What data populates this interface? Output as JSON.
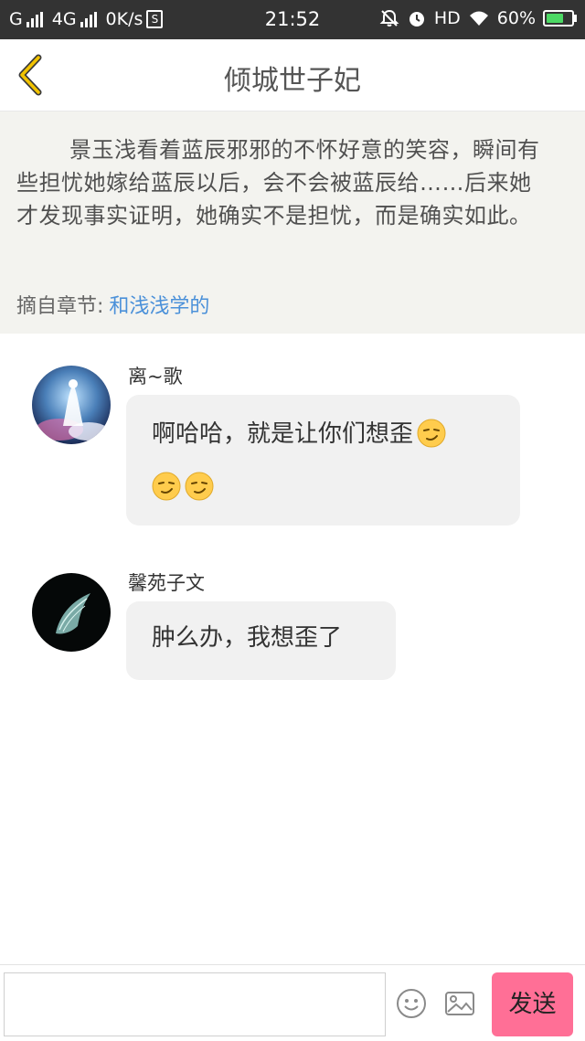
{
  "status_bar": {
    "carrier1": "G",
    "carrier2": "4G",
    "speed": "0K/s",
    "sim_icon_text": "S",
    "time": "21:52",
    "hd_label": "HD",
    "battery": "60%",
    "battery_level": 0.6,
    "battery_color": "#4cd964"
  },
  "header": {
    "title": "倾城世子妃",
    "back_icon": "chevron-left-icon",
    "accent": "#f2c300"
  },
  "excerpt": {
    "text": "景玉浅看着蓝辰邪邪的不怀好意的笑容，瞬间有些担忧她嫁给蓝辰以后，会不会被蓝辰给……后来她才发现事实证明，她确实不是担忧，而是确实如此。",
    "source_label": "摘自章节:",
    "source_chapter": "和浅浅学的"
  },
  "comments": [
    {
      "username": "离~歌",
      "text": "啊哈哈，就是让你们想歪",
      "emoji": [
        "smirk-emoji",
        "smirk-emoji",
        "smirk-emoji"
      ]
    },
    {
      "username": "馨苑子文",
      "text": "肿么办，我想歪了",
      "emoji": []
    }
  ],
  "input_bar": {
    "input_value": "",
    "emoji_icon": "smiley-icon",
    "image_icon": "image-icon",
    "send_label": "发送",
    "send_color": "#ff6f96"
  }
}
